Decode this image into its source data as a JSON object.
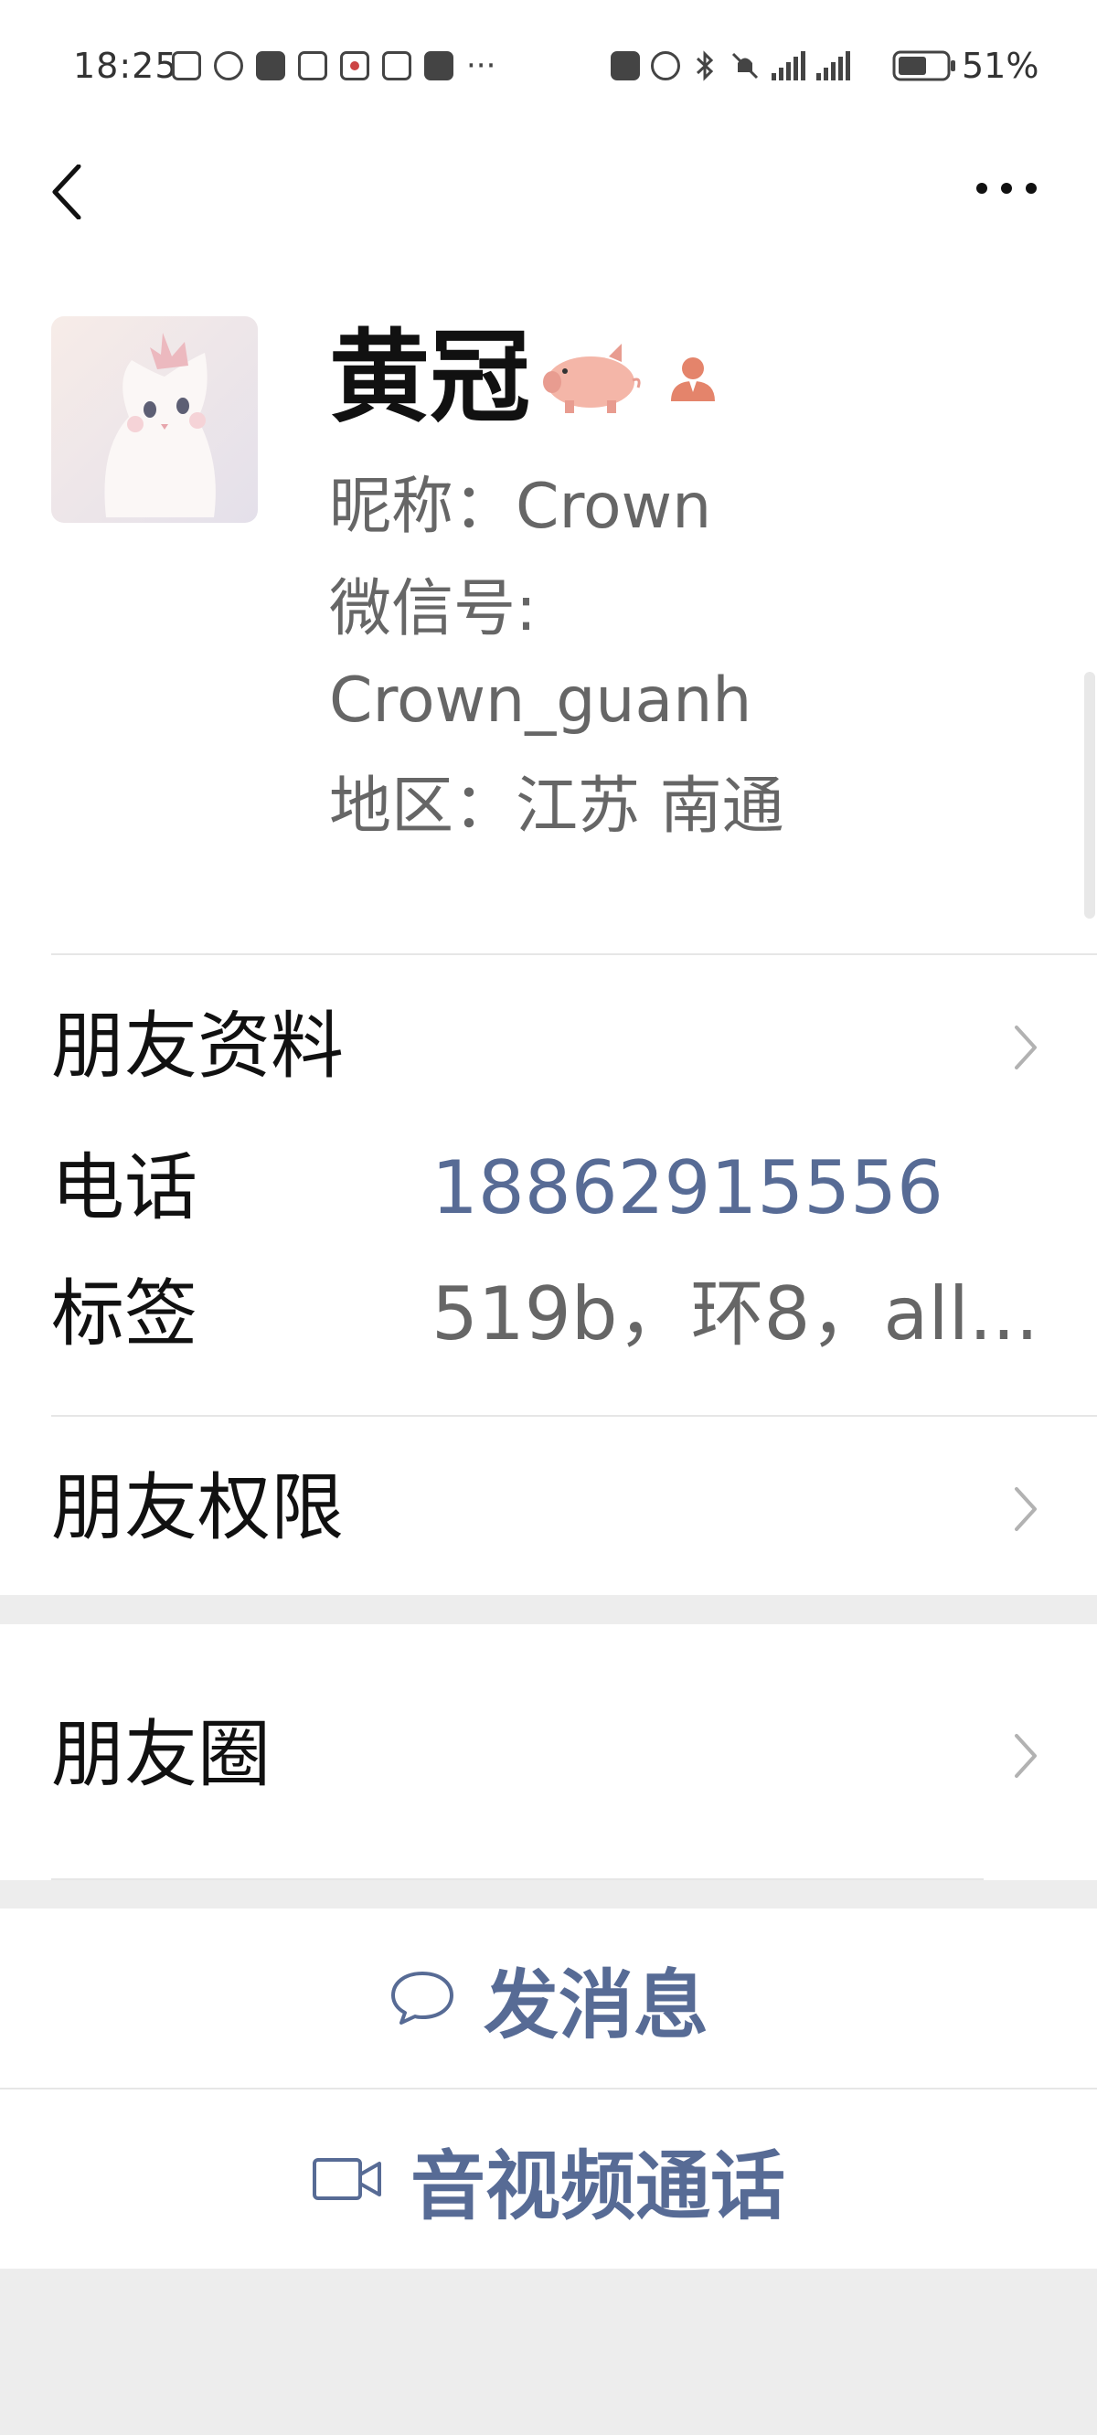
{
  "status_bar": {
    "time": "18:25",
    "battery": "51%",
    "left_icons": [
      "cast-icon",
      "eye-icon",
      "app-icon",
      "app-icon",
      "app-icon",
      "app-icon",
      "app-icon",
      "more-dots-icon"
    ],
    "right_icons": [
      "nfc-icon",
      "alarm-icon",
      "bluetooth-icon",
      "mute-icon",
      "signal-5g-icon",
      "signal-5g-icon"
    ]
  },
  "nav": {
    "back_icon": "chevron-left-icon",
    "more_icon": "more-horizontal-icon"
  },
  "profile": {
    "display_name": "黄冠",
    "name_emoji": "pig-icon",
    "badge_icon": "person-icon",
    "nickname": "昵称：Crown",
    "wechat_id_label": "微信号:",
    "wechat_id": "Crown_guanh",
    "region": "地区：江苏  南通"
  },
  "details": {
    "friend_info": "朋友资料",
    "phone_label": "电话",
    "phone_value": "18862915556",
    "tags_label": "标签",
    "tags_value": "519b，环8，all...",
    "permissions": "朋友权限",
    "moments": "朋友圈"
  },
  "actions": {
    "message": "发消息",
    "call": "音视频通话"
  },
  "colors": {
    "link": "#576b95",
    "background": "#ededed"
  }
}
